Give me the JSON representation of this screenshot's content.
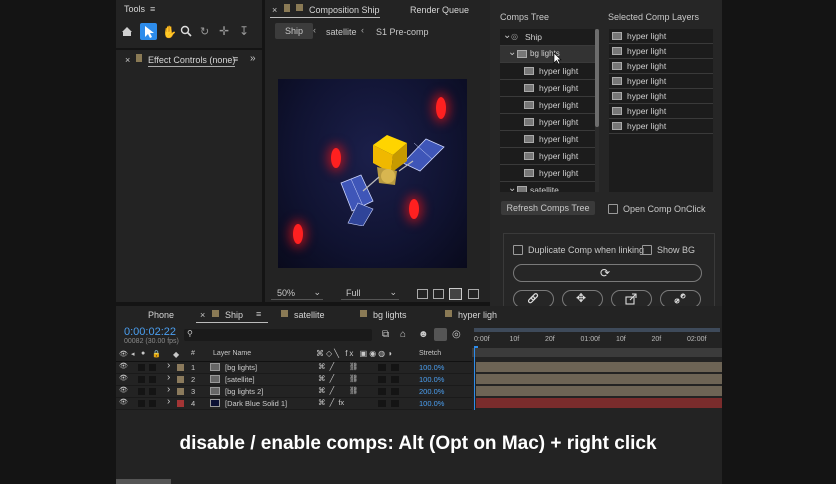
{
  "tools": {
    "title": "Tools"
  },
  "effect_controls": {
    "title": "Effect Controls (none)"
  },
  "composition": {
    "tab_title": "Composition Ship",
    "render_queue": "Render Queue",
    "breadcrumbs": [
      "Ship",
      "satellite",
      "S1 Pre-comp"
    ],
    "zoom": "50%",
    "resolution": "Full"
  },
  "comps_panel": {
    "tree_title": "Comps Tree",
    "selected_title": "Selected Comp Layers",
    "tree_items": [
      {
        "label": "Ship",
        "level": 0
      },
      {
        "label": "bg lights",
        "level": 1
      },
      {
        "label": "hyper light",
        "level": 2
      },
      {
        "label": "hyper light",
        "level": 2
      },
      {
        "label": "hyper light",
        "level": 2
      },
      {
        "label": "hyper light",
        "level": 2
      },
      {
        "label": "hyper light",
        "level": 2
      },
      {
        "label": "hyper light",
        "level": 2
      },
      {
        "label": "hyper light",
        "level": 2
      },
      {
        "label": "satellite",
        "level": 1
      }
    ],
    "selected_items": [
      "hyper light",
      "hyper light",
      "hyper light",
      "hyper light",
      "hyper light",
      "hyper light",
      "hyper light"
    ],
    "refresh_label": "Refresh Comps Tree",
    "open_comp_label": "Open Comp OnClick",
    "duplicate_label": "Duplicate Comp when linking",
    "show_bg_label": "Show BG"
  },
  "timeline": {
    "tabs": [
      "Phone",
      "Ship",
      "satellite",
      "bg lights",
      "hyper ligh"
    ],
    "timecode": "0:00:02:22",
    "frame_info": "00082 (30.00 fps)",
    "search_placeholder": "",
    "col_layer_name": "Layer Name",
    "col_stretch": "Stretch",
    "ruler": [
      "0:00f",
      "10f",
      "20f",
      "01:00f",
      "10f",
      "20f",
      "02:00f"
    ],
    "layers": [
      {
        "num": "1",
        "name": "[bg lights]",
        "stretch": "100.0%",
        "color": "#8b7a5c"
      },
      {
        "num": "2",
        "name": "[satellite]",
        "stretch": "100.0%",
        "color": "#8b7a5c"
      },
      {
        "num": "3",
        "name": "[bg lights 2]",
        "stretch": "200.0%",
        "color": "#8b7a5c"
      },
      {
        "num": "4",
        "name": "[Dark Blue Solid 1]",
        "stretch": "100.0%",
        "color": "#a33535"
      }
    ]
  },
  "caption": "disable / enable comps: Alt (Opt on Mac) + right click"
}
